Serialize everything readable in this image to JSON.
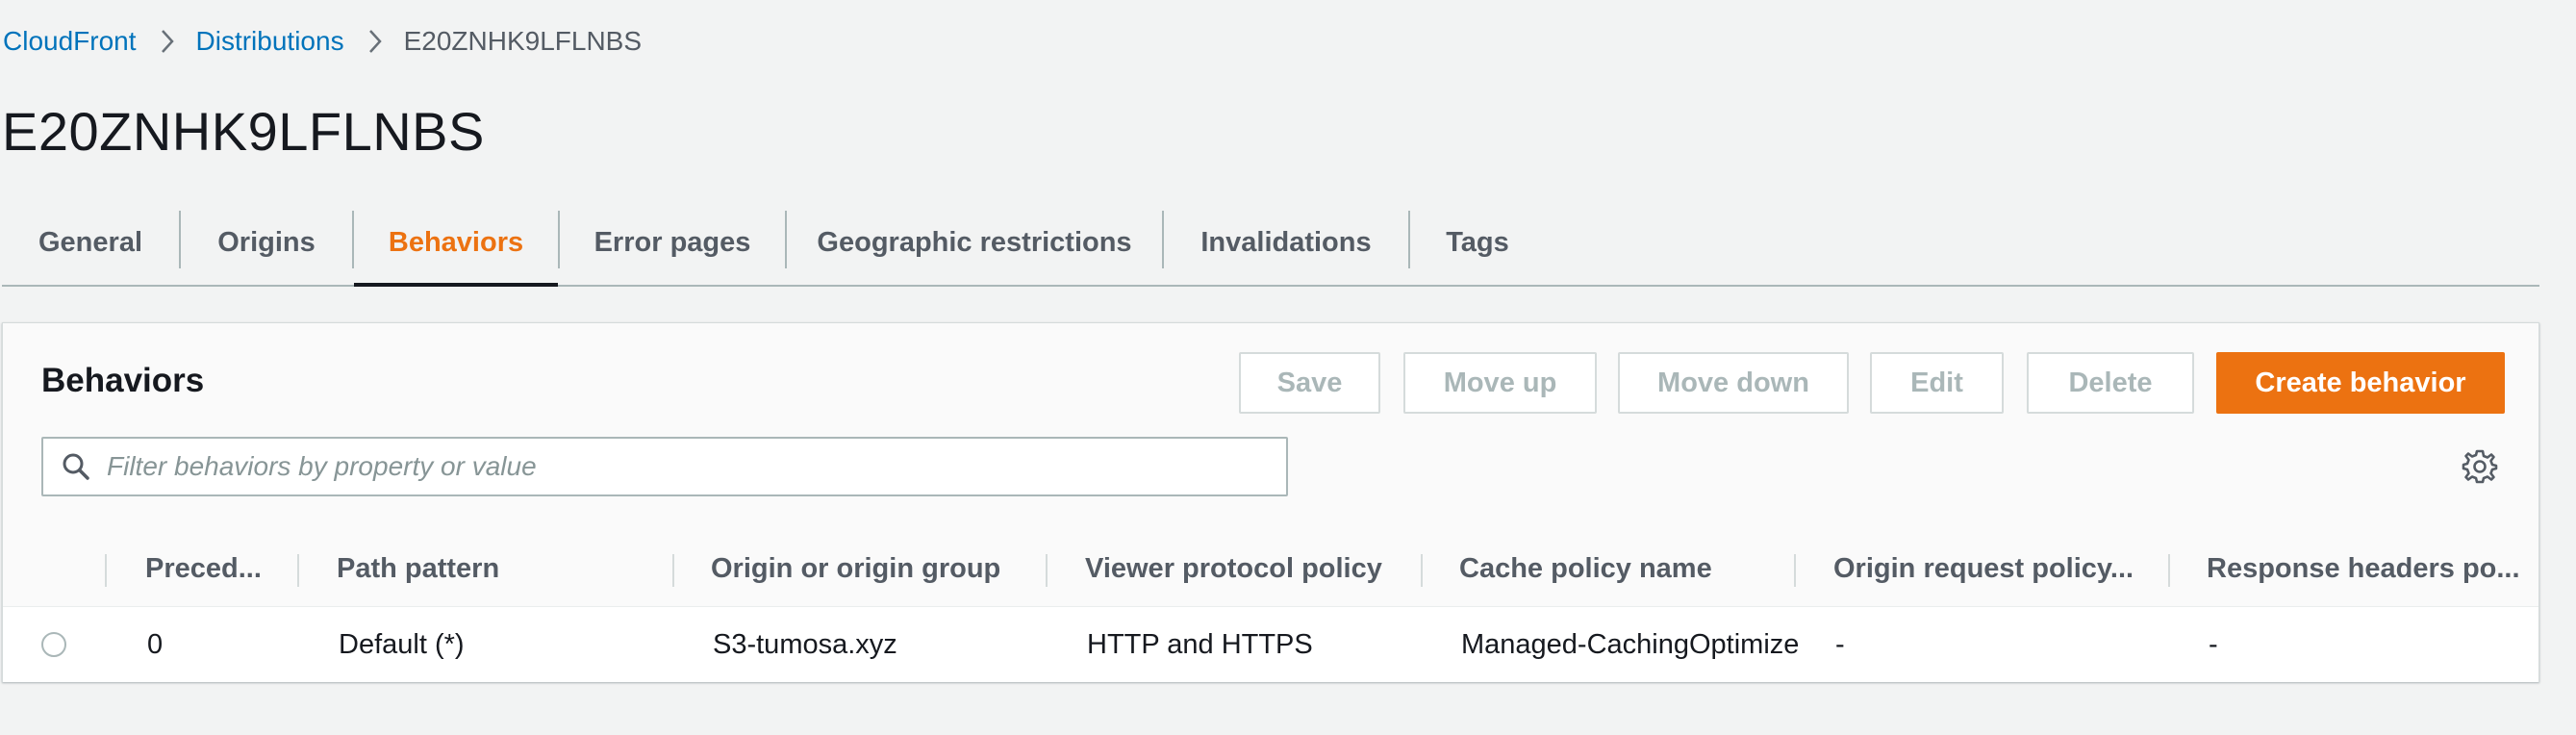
{
  "breadcrumb": {
    "items": [
      "CloudFront",
      "Distributions"
    ],
    "current": "E20ZNHK9LFLNBS"
  },
  "page": {
    "title": "E20ZNHK9LFLNBS"
  },
  "tabs": [
    {
      "label": "General",
      "active": false
    },
    {
      "label": "Origins",
      "active": false
    },
    {
      "label": "Behaviors",
      "active": true
    },
    {
      "label": "Error pages",
      "active": false
    },
    {
      "label": "Geographic restrictions",
      "active": false
    },
    {
      "label": "Invalidations",
      "active": false
    },
    {
      "label": "Tags",
      "active": false
    }
  ],
  "behaviors_panel": {
    "title": "Behaviors",
    "buttons": {
      "save": "Save",
      "move_up": "Move up",
      "move_down": "Move down",
      "edit": "Edit",
      "delete": "Delete",
      "create": "Create behavior"
    },
    "filter": {
      "placeholder": "Filter behaviors by property or value",
      "value": ""
    },
    "icons": {
      "search": "search-icon",
      "settings": "gear-icon",
      "separator": "chevron-right-icon"
    },
    "table": {
      "columns": [
        "Preced...",
        "Path pattern",
        "Origin or origin group",
        "Viewer protocol policy",
        "Cache policy name",
        "Origin request policy...",
        "Response headers po..."
      ],
      "rows": [
        {
          "selected": false,
          "cells": [
            "0",
            "Default (*)",
            "S3-tumosa.xyz",
            "HTTP and HTTPS",
            "Managed-CachingOptimized",
            "-",
            "-"
          ]
        }
      ]
    }
  },
  "colors": {
    "accent": "#ec7211",
    "link": "#0073bb",
    "text": "#16191f",
    "muted": "#545b64",
    "background": "#f2f3f3"
  }
}
